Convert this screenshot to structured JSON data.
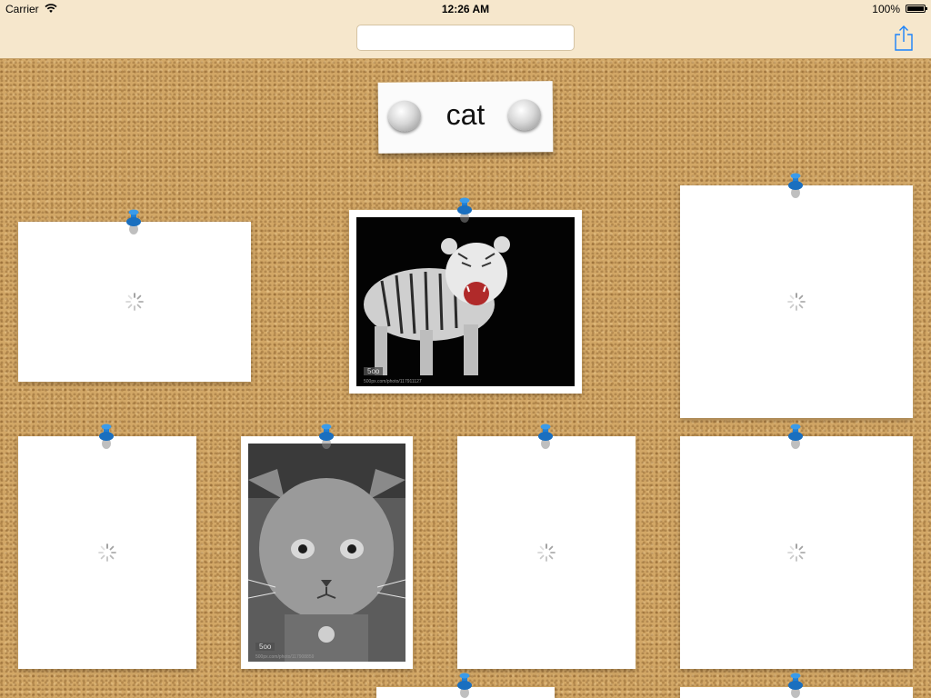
{
  "status_bar": {
    "carrier": "Carrier",
    "time": "12:26 AM",
    "battery": "100%"
  },
  "search": {
    "value": "",
    "placeholder": ""
  },
  "board": {
    "title": "cat"
  },
  "photos": {
    "tiger": {
      "badge": "5oo",
      "url": "500px.com/photo/117911127"
    },
    "cat": {
      "badge": "5oo",
      "url": "500px.com/photo/117908859"
    }
  },
  "colors": {
    "cork": "#d2a766",
    "topbar": "#f6e7cc",
    "pin_blue": "#1f7fd4",
    "ios_blue": "#1a82fb"
  },
  "icons": {
    "share": "share-icon",
    "pin": "push-pin-icon",
    "spinner": "loading-spinner-icon",
    "wifi": "wifi-icon",
    "battery": "battery-icon"
  }
}
